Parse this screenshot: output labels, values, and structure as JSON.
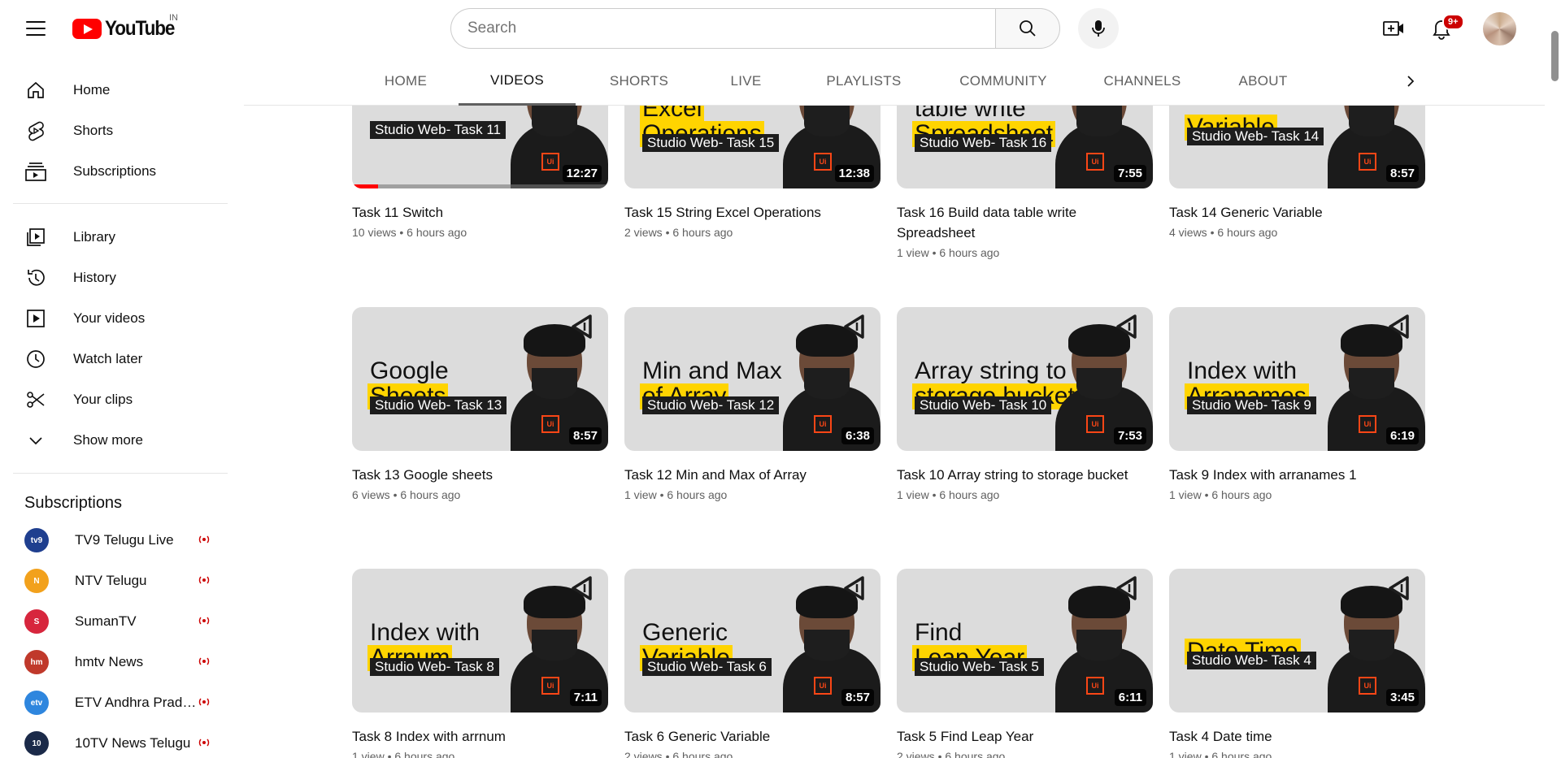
{
  "masthead": {
    "logo_text": "YouTube",
    "country_code": "IN",
    "search_placeholder": "Search",
    "notification_count": "9+"
  },
  "sidebar": {
    "main": [
      {
        "label": "Home",
        "icon": "home-icon"
      },
      {
        "label": "Shorts",
        "icon": "shorts-icon"
      },
      {
        "label": "Subscriptions",
        "icon": "subscriptions-icon"
      }
    ],
    "library": [
      {
        "label": "Library",
        "icon": "library-icon"
      },
      {
        "label": "History",
        "icon": "history-icon"
      },
      {
        "label": "Your videos",
        "icon": "your-videos-icon"
      },
      {
        "label": "Watch later",
        "icon": "watch-later-icon"
      },
      {
        "label": "Your clips",
        "icon": "scissors-icon"
      },
      {
        "label": "Show more",
        "icon": "chevron-down-icon"
      }
    ],
    "subscriptions_title": "Subscriptions",
    "subscriptions": [
      {
        "label": "TV9 Telugu Live",
        "color": "#1f3f8f",
        "live": true
      },
      {
        "label": "NTV Telugu",
        "color": "#f2a11c",
        "live": true
      },
      {
        "label": "SumanTV",
        "color": "#d7263d",
        "live": true
      },
      {
        "label": "hmtv News",
        "color": "#c0392b",
        "live": true
      },
      {
        "label": "ETV Andhra Pradesh",
        "color": "#2e86de",
        "live": true
      },
      {
        "label": "10TV News Telugu",
        "color": "#1b2a49",
        "live": true
      }
    ]
  },
  "tabs": [
    {
      "label": "HOME",
      "active": false
    },
    {
      "label": "VIDEOS",
      "active": true
    },
    {
      "label": "SHORTS",
      "active": false
    },
    {
      "label": "LIVE",
      "active": false
    },
    {
      "label": "PLAYLISTS",
      "active": false
    },
    {
      "label": "COMMUNITY",
      "active": false
    },
    {
      "label": "CHANNELS",
      "active": false
    },
    {
      "label": "ABOUT",
      "active": false
    }
  ],
  "videos": [
    {
      "title": "Task 11 Switch",
      "views": "10 views",
      "age": "6 hours ago",
      "duration": "12:27",
      "thumb_lines": [],
      "thumb_task": "Studio Web- Task 11",
      "watch_progress": 0.1
    },
    {
      "title": "Task 15 String Excel Operations",
      "views": "2 views",
      "age": "6 hours ago",
      "duration": "12:38",
      "thumb_lines": [
        {
          "text": "Excel",
          "hl": true
        },
        {
          "text": "Operations",
          "hl": true
        }
      ],
      "thumb_task": "Studio Web- Task 15"
    },
    {
      "title": "Task 16 Build data table write Spreadsheet",
      "views": "1 view",
      "age": "6 hours ago",
      "duration": "7:55",
      "thumb_lines": [
        {
          "text": "table write",
          "hl": false
        },
        {
          "text": "Spreadsheet",
          "hl": true
        }
      ],
      "thumb_task": "Studio Web- Task 16"
    },
    {
      "title": "Task 14 Generic Variable",
      "views": "4 views",
      "age": "6 hours ago",
      "duration": "8:57",
      "thumb_lines": [
        {
          "text": "Variable",
          "hl": true
        }
      ],
      "thumb_task": "Studio Web- Task 14"
    },
    {
      "title": "Task 13 Google sheets",
      "views": "6 views",
      "age": "6 hours ago",
      "duration": "8:57",
      "thumb_lines": [
        {
          "text": "Google",
          "hl": false
        },
        {
          "text": "Sheets",
          "hl": true
        }
      ],
      "thumb_task": "Studio Web- Task 13"
    },
    {
      "title": "Task 12 Min and Max of Array",
      "views": "1 view",
      "age": "6 hours ago",
      "duration": "6:38",
      "thumb_lines": [
        {
          "text": "Min and Max",
          "hl": false
        },
        {
          "text": "of Array",
          "hl": true
        }
      ],
      "thumb_task": "Studio Web- Task 12"
    },
    {
      "title": "Task 10 Array string to storage bucket",
      "views": "1 view",
      "age": "6 hours ago",
      "duration": "7:53",
      "thumb_lines": [
        {
          "text": "Array string to",
          "hl": false
        },
        {
          "text": "storage bucket",
          "hl": true
        }
      ],
      "thumb_task": "Studio Web- Task 10"
    },
    {
      "title": "Task 9 Index with arranames 1",
      "views": "1 view",
      "age": "6 hours ago",
      "duration": "6:19",
      "thumb_lines": [
        {
          "text": "Index with",
          "hl": false
        },
        {
          "text": "Arranames",
          "hl": true
        }
      ],
      "thumb_task": "Studio Web- Task 9"
    },
    {
      "title": "Task 8 Index with arrnum",
      "views": "1 view",
      "age": "6 hours ago",
      "duration": "7:11",
      "thumb_lines": [
        {
          "text": "Index with",
          "hl": false
        },
        {
          "text": "Arrnum",
          "hl": true
        }
      ],
      "thumb_task": "Studio Web- Task 8"
    },
    {
      "title": "Task 6 Generic Variable",
      "views": "2 views",
      "age": "6 hours ago",
      "duration": "8:57",
      "thumb_lines": [
        {
          "text": "Generic",
          "hl": false
        },
        {
          "text": "Variable",
          "hl": true
        }
      ],
      "thumb_task": "Studio Web- Task 6"
    },
    {
      "title": "Task 5 Find Leap Year",
      "views": "2 views",
      "age": "6 hours ago",
      "duration": "6:11",
      "thumb_lines": [
        {
          "text": "Find",
          "hl": false
        },
        {
          "text": "Leap Year",
          "hl": true
        }
      ],
      "thumb_task": "Studio Web- Task 5"
    },
    {
      "title": "Task 4 Date time",
      "views": "1 view",
      "age": "6 hours ago",
      "duration": "3:45",
      "thumb_lines": [
        {
          "text": "Date Time",
          "hl": true
        }
      ],
      "thumb_task": "Studio Web- Task 4"
    }
  ],
  "badge_text": "UiPath"
}
